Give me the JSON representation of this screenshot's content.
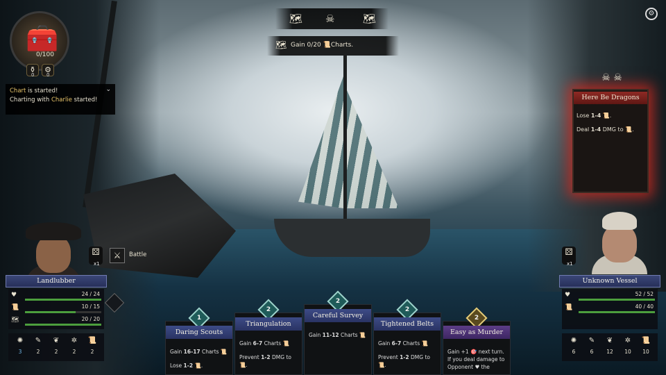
{
  "hud": {
    "chest_count": "0/100",
    "mini_left_count": "0",
    "mini_right_count": "0",
    "settings_icon": "gear-icon"
  },
  "log": {
    "line1_highlight": "Chart",
    "line1_rest": " is started!",
    "line2_prefix": "Charting with ",
    "line2_highlight": "Charlie",
    "line2_rest": " started!"
  },
  "objective": {
    "prefix": "Gain 0/20",
    "suffix": "Charts."
  },
  "encounter": {
    "title": "Here Be Dragons",
    "line1_prefix": "Lose ",
    "line1_value": "1-4",
    "line2_prefix": "Deal ",
    "line2_value": "1-4",
    "line2_mid": " DMG to"
  },
  "player": {
    "name": "Landlubber",
    "dice_count": "x1",
    "battle_label": "Battle",
    "stats": [
      {
        "value": "24 / 24",
        "fraction": 1.0,
        "icon": "heart-icon"
      },
      {
        "value": "10 / 15",
        "fraction": 0.667,
        "icon": "scroll-icon"
      },
      {
        "value": "20 / 20",
        "fraction": 1.0,
        "icon": "map-icon"
      }
    ],
    "resources": [
      "3",
      "2",
      "2",
      "2",
      "2"
    ]
  },
  "opponent": {
    "name": "Unknown Vessel",
    "dice_count": "x1",
    "stats": [
      {
        "value": "52 / 52",
        "fraction": 1.0,
        "icon": "heart-icon"
      },
      {
        "value": "40 / 40",
        "fraction": 1.0,
        "icon": "scroll-icon"
      }
    ],
    "resources": [
      "6",
      "6",
      "12",
      "10",
      "10"
    ]
  },
  "cards": [
    {
      "cost": "1",
      "title": "Daring Scouts",
      "l1a": "Gain ",
      "l1b": "16-17",
      "l1c": " Charts",
      "l2a": "Lose ",
      "l2b": "1-2",
      "l2c": ""
    },
    {
      "cost": "2",
      "title": "Triangulation",
      "l1a": "Gain ",
      "l1b": "6-7",
      "l1c": " Charts",
      "l2a": "Prevent ",
      "l2b": "1-2",
      "l2c": " DMG to"
    },
    {
      "cost": "2",
      "title": "Careful Survey",
      "l1a": "Gain ",
      "l1b": "11-12",
      "l1c": " Charts",
      "l2a": "",
      "l2b": "",
      "l2c": ""
    },
    {
      "cost": "2",
      "title": "Tightened Belts",
      "l1a": "Gain ",
      "l1b": "6-7",
      "l1c": " Charts",
      "l2a": "Prevent ",
      "l2b": "1-2",
      "l2c": " DMG to"
    },
    {
      "cost": "2",
      "title": "Easy as Murder",
      "l1a": "Gain +1",
      "l1b": "",
      "l1c": " next turn.",
      "l2a": "If you deal damage to Opponent",
      "l2b": "",
      "l2c": " the"
    }
  ]
}
